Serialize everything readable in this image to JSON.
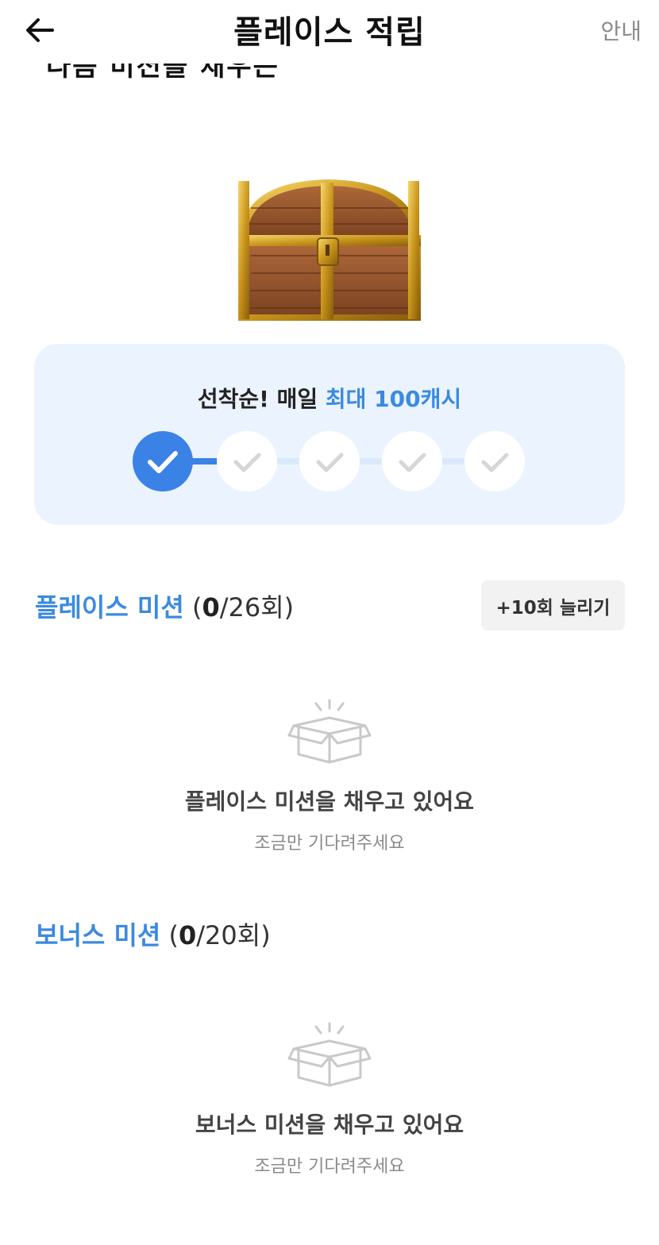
{
  "header": {
    "title": "플레이스 적립",
    "guide_label": "안내"
  },
  "partial_text": "다음 미션을 채우는 중이에요",
  "reward": {
    "text_prefix": "선착순! 매일 ",
    "text_highlight": "최대 100캐시",
    "steps_completed": 1,
    "steps_total": 5
  },
  "place_mission": {
    "name": "플레이스 미션",
    "open": "(",
    "done": "0",
    "rest": "/26회)",
    "extend_label": "+10회 늘리기",
    "empty_title": "플레이스 미션을 채우고 있어요",
    "empty_sub": "조금만 기다려주세요"
  },
  "bonus_mission": {
    "name": "보너스 미션",
    "open": "(",
    "done": "0",
    "rest": "/20회)",
    "empty_title": "보너스 미션을 채우고 있어요",
    "empty_sub": "조금만 기다려주세요"
  },
  "colors": {
    "accent": "#3b82e6",
    "card_bg": "#ebf3fe",
    "muted": "#8a8a8a"
  }
}
